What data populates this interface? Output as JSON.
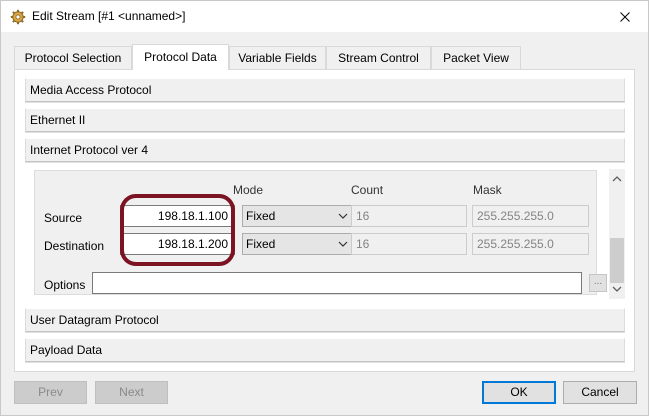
{
  "window": {
    "title": "Edit Stream [#1 <unnamed>]"
  },
  "tabs": [
    {
      "label": "Protocol Selection",
      "active": false
    },
    {
      "label": "Protocol Data",
      "active": true
    },
    {
      "label": "Variable Fields",
      "active": false
    },
    {
      "label": "Stream Control",
      "active": false
    },
    {
      "label": "Packet View",
      "active": false
    }
  ],
  "sections": {
    "mac": "Media Access Protocol",
    "ethernet": "Ethernet II",
    "ipv4": "Internet Protocol ver 4",
    "udp": "User Datagram Protocol",
    "payload": "Payload Data"
  },
  "ip": {
    "columns": {
      "mode": "Mode",
      "count": "Count",
      "mask": "Mask"
    },
    "source": {
      "label": "Source",
      "address": "198.18.1.100",
      "mode": "Fixed",
      "count": "16",
      "mask": "255.255.255.0"
    },
    "destination": {
      "label": "Destination",
      "address": "198.18.1.200",
      "mode": "Fixed",
      "count": "16",
      "mask": "255.255.255.0"
    },
    "options": {
      "label": "Options",
      "value": "",
      "browse_label": "..."
    }
  },
  "buttons": {
    "prev": "Prev",
    "next": "Next",
    "ok": "OK",
    "cancel": "Cancel"
  },
  "colors": {
    "highlight": "#7b1323",
    "focus": "#0078d7"
  }
}
